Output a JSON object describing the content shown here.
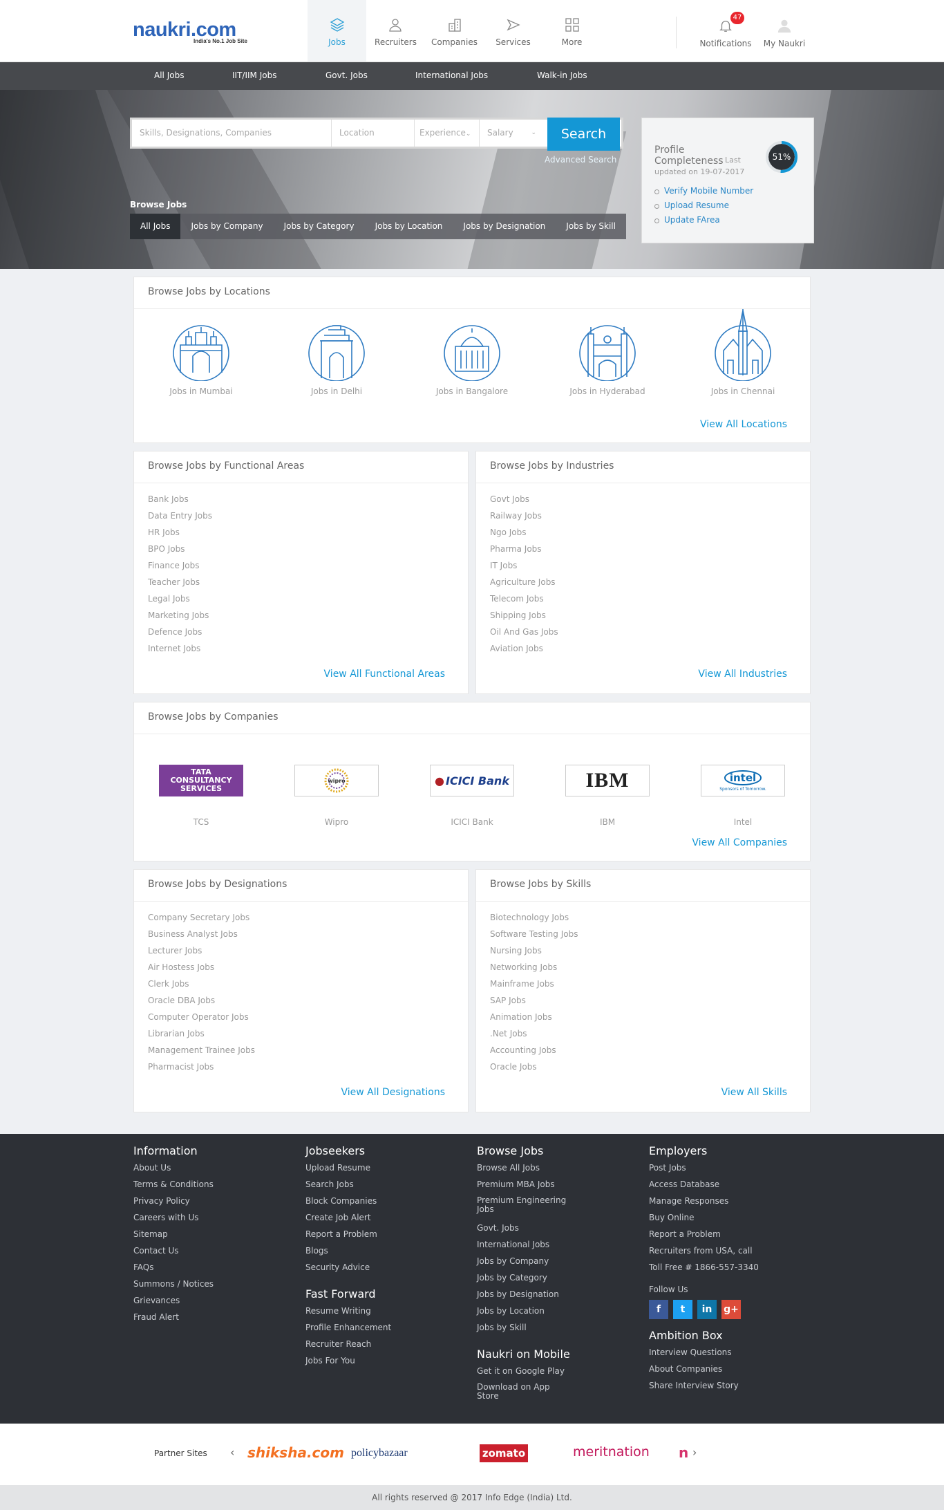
{
  "header": {
    "logo_text": "naukri.com",
    "logo_tagline": "India's No.1 Job Site",
    "nav": [
      {
        "label": "Jobs",
        "icon": "layers-icon"
      },
      {
        "label": "Recruiters",
        "icon": "recruiter-icon"
      },
      {
        "label": "Companies",
        "icon": "building-icon"
      },
      {
        "label": "Services",
        "icon": "play-icon"
      },
      {
        "label": "More",
        "icon": "grid-icon"
      }
    ],
    "notifications_label": "Notifications",
    "notifications_count": "47",
    "my_naukri_label": "My Naukri"
  },
  "subnav": [
    "All Jobs",
    "IIT/IIM Jobs",
    "Govt. Jobs",
    "International Jobs",
    "Walk-in Jobs"
  ],
  "search": {
    "keywords_placeholder": "Skills, Designations, Companies",
    "location_placeholder": "Location",
    "experience_placeholder": "Experience",
    "salary_placeholder": "Salary",
    "button": "Search",
    "advanced": "Advanced Search"
  },
  "browse": {
    "label": "Browse Jobs",
    "tabs": [
      "All Jobs",
      "Jobs by Company",
      "Jobs by Category",
      "Jobs by Location",
      "Jobs by Designation",
      "Jobs by Skill"
    ]
  },
  "profile": {
    "title": "Profile Completeness",
    "last_label": "Last",
    "updated": "updated on 19-07-2017",
    "percent": "51%",
    "percent_value": 51,
    "links": [
      "Verify Mobile Number",
      "Upload Resume",
      "Update FArea"
    ]
  },
  "locations": {
    "title": "Browse Jobs by Locations",
    "items": [
      "Jobs in Mumbai",
      "Jobs in Delhi",
      "Jobs in Bangalore",
      "Jobs in Hyderabad",
      "Jobs in Chennai"
    ],
    "view_all": "View All Locations"
  },
  "functional": {
    "title": "Browse Jobs by Functional Areas",
    "items": [
      "Bank Jobs",
      "Data Entry Jobs",
      "HR Jobs",
      "BPO Jobs",
      "Finance Jobs",
      "Teacher Jobs",
      "Legal Jobs",
      "Marketing Jobs",
      "Defence Jobs",
      "Internet Jobs"
    ],
    "view_all": "View All Functional Areas"
  },
  "industries": {
    "title": "Browse Jobs by Industries",
    "items": [
      "Govt Jobs",
      "Railway Jobs",
      "Ngo Jobs",
      "Pharma Jobs",
      "IT Jobs",
      "Agriculture Jobs",
      "Telecom Jobs",
      "Shipping Jobs",
      "Oil And Gas Jobs",
      "Aviation Jobs"
    ],
    "view_all": "View All Industries"
  },
  "companies": {
    "title": "Browse Jobs by Companies",
    "items": [
      {
        "name": "TCS",
        "logo": "TATA CONSULTANCY SERVICES"
      },
      {
        "name": "Wipro",
        "logo": "wipro"
      },
      {
        "name": "ICICI Bank",
        "logo": "ICICI Bank"
      },
      {
        "name": "IBM",
        "logo": "IBM"
      },
      {
        "name": "Intel",
        "logo": "intel"
      }
    ],
    "intel_sub": "Sponsors of Tomorrow.",
    "view_all": "View All Companies"
  },
  "designations": {
    "title": "Browse Jobs by Designations",
    "items": [
      "Company Secretary Jobs",
      "Business Analyst Jobs",
      "Lecturer Jobs",
      "Air Hostess Jobs",
      "Clerk Jobs",
      "Oracle DBA Jobs",
      "Computer Operator Jobs",
      "Librarian Jobs",
      "Management Trainee Jobs",
      "Pharmacist Jobs"
    ],
    "view_all": "View All Designations"
  },
  "skills": {
    "title": "Browse Jobs by Skills",
    "items": [
      "Biotechnology Jobs",
      "Software Testing Jobs",
      "Nursing Jobs",
      "Networking Jobs",
      "Mainframe Jobs",
      "SAP Jobs",
      "Animation Jobs",
      ".Net Jobs",
      "Accounting Jobs",
      "Oracle Jobs"
    ],
    "view_all": "View All Skills"
  },
  "footer": {
    "information": {
      "title": "Information",
      "links": [
        "About Us",
        "Terms & Conditions",
        "Privacy Policy",
        "Careers with Us",
        "Sitemap",
        "Contact Us",
        "FAQs",
        "Summons / Notices",
        "Grievances",
        "Fraud Alert"
      ]
    },
    "jobseekers": {
      "title": "Jobseekers",
      "links": [
        "Upload Resume",
        "Search Jobs",
        "Block Companies",
        "Create Job Alert",
        "Report a Problem",
        "Blogs",
        "Security Advice"
      ]
    },
    "fast_forward": {
      "title": "Fast Forward",
      "links": [
        "Resume Writing",
        "Profile Enhancement",
        "Recruiter Reach",
        "Jobs For You"
      ]
    },
    "browse_jobs": {
      "title": "Browse Jobs",
      "links": [
        "Browse All Jobs",
        "Premium MBA Jobs",
        "Premium Engineering Jobs",
        "Govt. Jobs",
        "International Jobs",
        "Jobs by Company",
        "Jobs by Category",
        "Jobs by Designation",
        "Jobs by Location",
        "Jobs by Skill"
      ]
    },
    "mobile": {
      "title": "Naukri on Mobile",
      "links": [
        "Get it on Google Play",
        "Download on App Store"
      ]
    },
    "employers": {
      "title": "Employers",
      "links": [
        "Post Jobs",
        "Access Database",
        "Manage Responses",
        "Buy Online",
        "Report a Problem",
        "Recruiters from USA, call",
        "Toll Free # 1866-557-3340"
      ]
    },
    "follow_us": "Follow Us",
    "social": [
      {
        "name": "facebook",
        "glyph": "f",
        "color": "#3b5998"
      },
      {
        "name": "twitter",
        "glyph": "t",
        "color": "#1da1f2"
      },
      {
        "name": "linkedin",
        "glyph": "in",
        "color": "#0e76a8"
      },
      {
        "name": "google-plus",
        "glyph": "g+",
        "color": "#dd4b39"
      }
    ],
    "ambition": {
      "title": "Ambition Box",
      "links": [
        "Interview Questions",
        "About Companies",
        "Share Interview Story"
      ]
    }
  },
  "partners": {
    "label": "Partner Sites",
    "sites": [
      "shiksha.com",
      "policybazaar",
      "zomato",
      "meritnation"
    ]
  },
  "copyright": "All rights reserved @ 2017 Info Edge (India) Ltd."
}
